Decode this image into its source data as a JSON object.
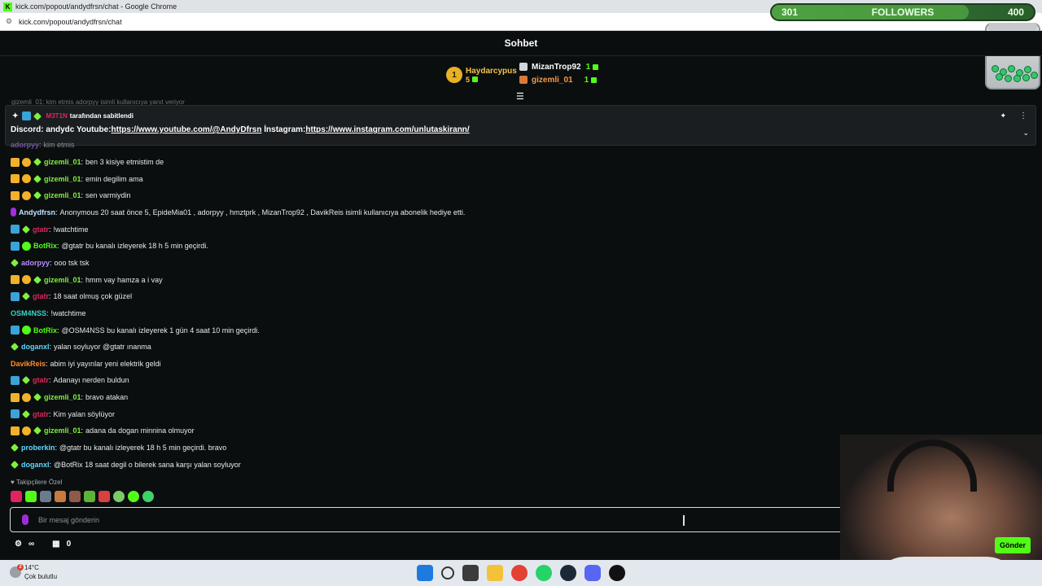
{
  "browser": {
    "window_title": "kick.com/popout/andydfrsn/chat - Google Chrome",
    "url": "kick.com/popout/andydfrsn/chat"
  },
  "overlay": {
    "followers_current": "301",
    "followers_label": "FOLLOWERS",
    "followers_goal": "400",
    "progress_fraction": 0.75
  },
  "chat": {
    "header_title": "Sohbet",
    "leaderboard": {
      "first": {
        "rank": "1",
        "name": "Haydarcypus",
        "count": "5"
      },
      "second": {
        "name": "MizanTrop92",
        "count": "1"
      },
      "third": {
        "name": "gizemli_01",
        "count": "1"
      }
    },
    "ghost_line": "gizemli_01: kim etmis adorpyy isimli kullanıcıya yanıt veriyor",
    "pinned": {
      "pinned_by_user": "M3T1N",
      "pinned_by_text": "tarafından sabitlendi",
      "text_prefix": "Discord: andydc Youtube:",
      "youtube_link": "https://www.youtube.com/@AndyDfrsn",
      "instagram_label": " İnstagram:",
      "instagram_link": "https://www.instagram.com/unlutaskirann/"
    },
    "partial_top": {
      "user": "adorpyy",
      "text": "kim etmis"
    },
    "messages": [
      {
        "user": "gizemli_01",
        "color": "#7ef13e",
        "badges": [
          "crown",
          "one",
          "spark"
        ],
        "text": "ben 3 kisiye etmistim de"
      },
      {
        "user": "gizemli_01",
        "color": "#7ef13e",
        "badges": [
          "crown",
          "one",
          "spark"
        ],
        "text": "emin degilim ama"
      },
      {
        "user": "gizemli_01",
        "color": "#7ef13e",
        "badges": [
          "crown",
          "one",
          "spark"
        ],
        "text": "sen varmiydin"
      },
      {
        "user": "Andydfrsn",
        "color": "#bfe3ff",
        "badges": [
          "mic"
        ],
        "text": "Anonymous 20 saat önce 5, EpideMia01 , adorpyy , hmztprk , MizanTrop92 , DavikReis isimli kullanıcıya abonelik hediye etti."
      },
      {
        "user": "gtatr",
        "color": "#e0245e",
        "badges": [
          "bot2",
          "spark"
        ],
        "text": "!watchtime"
      },
      {
        "user": "BotRix",
        "color": "#53fc18",
        "badges": [
          "bot",
          "gear"
        ],
        "text": "@gtatr bu kanalı izleyerek 18 h 5 min geçirdi."
      },
      {
        "user": "adorpyy",
        "color": "#b88cff",
        "badges": [
          "spark"
        ],
        "text": "ooo tsk tsk"
      },
      {
        "user": "gizemli_01",
        "color": "#7ef13e",
        "badges": [
          "crown",
          "one",
          "spark"
        ],
        "text": "hmm vay hamza a i vay"
      },
      {
        "user": "gtatr",
        "color": "#e0245e",
        "badges": [
          "bot2",
          "spark"
        ],
        "text": "18 saat olmuş çok güzel"
      },
      {
        "user": "OSM4NSS",
        "color": "#3bd3c3",
        "badges": [],
        "text": "!watchtime"
      },
      {
        "user": "BotRix",
        "color": "#53fc18",
        "badges": [
          "bot",
          "gear"
        ],
        "text": "@OSM4NSS bu kanalı izleyerek 1 gün 4 saat 10 min geçirdi."
      },
      {
        "user": "doganxl",
        "color": "#5fd9ff",
        "badges": [
          "spark"
        ],
        "text": "yalan soyluyor @gtatr ınanma"
      },
      {
        "user": "DavikReis",
        "color": "#ff8c2e",
        "badges": [],
        "text": "abim iyi yayınlar yeni elektrik geldi"
      },
      {
        "user": "gtatr",
        "color": "#e0245e",
        "badges": [
          "bot2",
          "spark"
        ],
        "text": "Adanayı nerden buldun"
      },
      {
        "user": "gizemli_01",
        "color": "#7ef13e",
        "badges": [
          "crown",
          "one",
          "spark"
        ],
        "text": "bravo atakan"
      },
      {
        "user": "gtatr",
        "color": "#e0245e",
        "badges": [
          "bot2",
          "spark"
        ],
        "text": "Kim yalan söylüyor"
      },
      {
        "user": "gizemli_01",
        "color": "#7ef13e",
        "badges": [
          "crown",
          "one",
          "spark"
        ],
        "text": "adana da dogan minnina olmuyor"
      },
      {
        "user": "proberkin",
        "color": "#5fd9ff",
        "badges": [
          "spark"
        ],
        "text": "@gtatr bu kanalı izleyerek 18 h 5 min geçirdi. bravo"
      },
      {
        "user": "doganxl",
        "color": "#5fd9ff",
        "badges": [
          "spark"
        ],
        "text": "@BotRix 18 saat degil o bilerek sana karşı yalan soyluyor"
      }
    ],
    "followers_only_label": "Takipçilere Özel",
    "input_placeholder": "Bir mesaj gönderin",
    "bottom": {
      "infinity_label": "∞",
      "points": "0"
    },
    "send_label": "Gönder"
  },
  "taskbar": {
    "temperature": "14°C",
    "weather_desc": "Çok bulutlu",
    "notification_count": "2"
  },
  "colors": {
    "accent": "#53fc18",
    "background": "#0b0e0f",
    "pinned_bg": "#1b1e21"
  }
}
